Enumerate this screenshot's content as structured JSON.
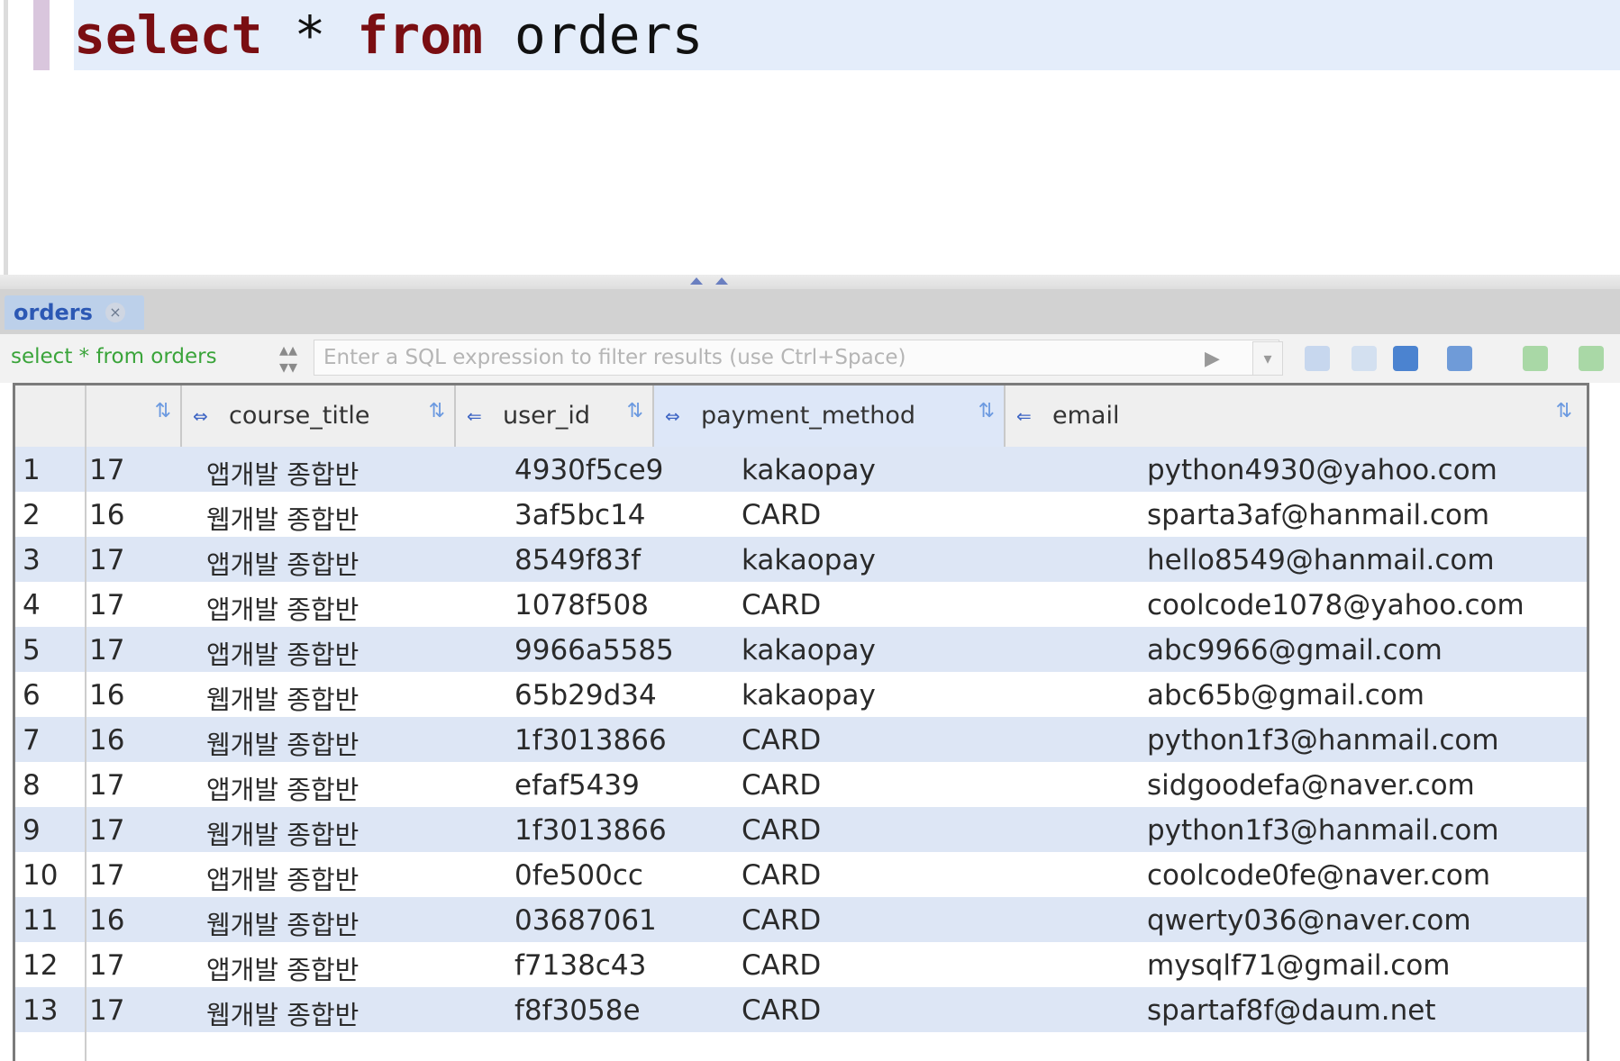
{
  "editor": {
    "keyword_select": "select",
    "star": "*",
    "keyword_from": "from",
    "table": "orders"
  },
  "results": {
    "tab_label": "orders",
    "filter": {
      "query": "select * from orders",
      "placeholder": "Enter a SQL expression to filter results (use Ctrl+Space)"
    },
    "columns": [
      "",
      "course_title",
      "user_id",
      "payment_method",
      "email"
    ],
    "rows": [
      [
        "1",
        "17",
        "앱개발 종합반",
        "4930f5ce9",
        "kakaopay",
        "python4930@yahoo.com"
      ],
      [
        "2",
        "16",
        "웹개발 종합반",
        "3af5bc14",
        "CARD",
        "sparta3af@hanmail.com"
      ],
      [
        "3",
        "17",
        "앱개발 종합반",
        "8549f83f",
        "kakaopay",
        "hello8549@hanmail.com"
      ],
      [
        "4",
        "17",
        "앱개발 종합반",
        "1078f508",
        "CARD",
        "coolcode1078@yahoo.com"
      ],
      [
        "5",
        "17",
        "앱개발 종합반",
        "9966a5585",
        "kakaopay",
        "abc9966@gmail.com"
      ],
      [
        "6",
        "16",
        "웹개발 종합반",
        "65b29d34",
        "kakaopay",
        "abc65b@gmail.com"
      ],
      [
        "7",
        "16",
        "웹개발 종합반",
        "1f3013866",
        "CARD",
        "python1f3@hanmail.com"
      ],
      [
        "8",
        "17",
        "앱개발 종합반",
        "efaf5439",
        "CARD",
        "sidgoodefa@naver.com"
      ],
      [
        "9",
        "17",
        "웹개발 종합반",
        "1f3013866",
        "CARD",
        "python1f3@hanmail.com"
      ],
      [
        "10",
        "17",
        "앱개발 종합반",
        "0fe500cc",
        "CARD",
        "coolcode0fe@naver.com"
      ],
      [
        "11",
        "16",
        "웹개발 종합반",
        "03687061",
        "CARD",
        "qwerty036@naver.com"
      ],
      [
        "12",
        "17",
        "앱개발 종합반",
        "f7138c43",
        "CARD",
        "mysqlf71@gmail.com"
      ],
      [
        "13",
        "17",
        "웹개발 종합반",
        "f8f3058e",
        "CARD",
        "spartaf8f@daum.net"
      ]
    ]
  },
  "colors": {
    "keyword": "#7a0e12",
    "current_line": "#e4edfa",
    "alt_row": "#dde6f5",
    "filter_query": "#3aa43a"
  },
  "icons": [
    "tab-close-icon",
    "filter-arrows-icon",
    "filter-run-icon",
    "filter-history-icon",
    "sort-icon",
    "key-icon"
  ]
}
